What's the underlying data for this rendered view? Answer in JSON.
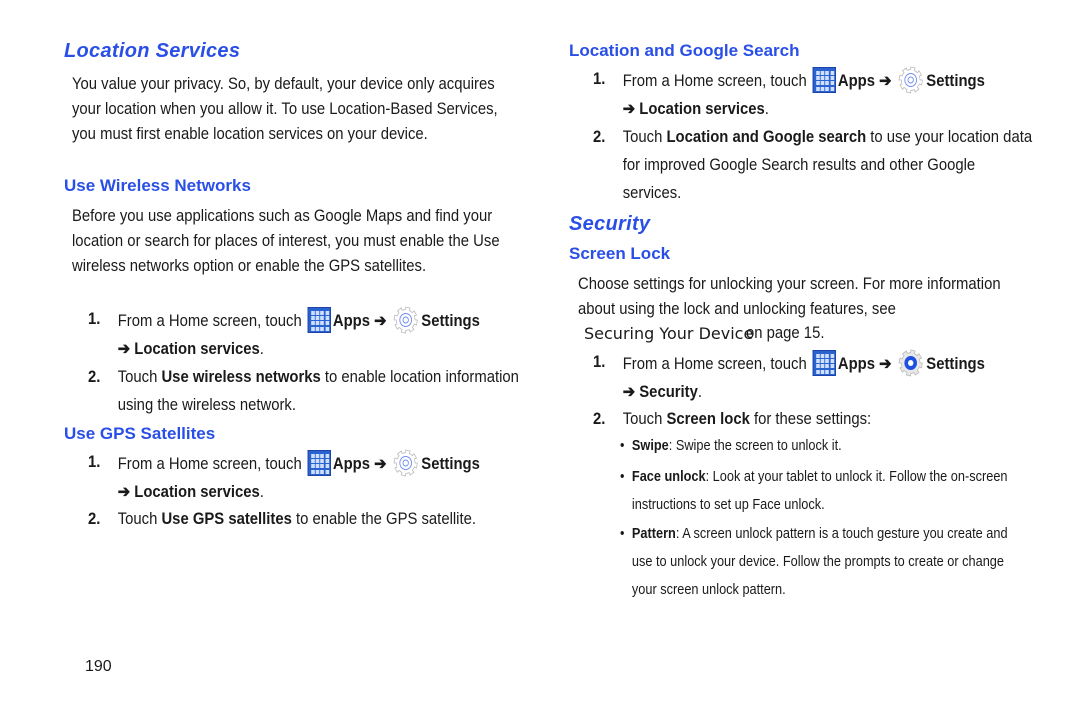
{
  "page_number": "190",
  "left": {
    "title": "Location Services",
    "intro": "You value your privacy. So, by default, your device only acquires your location when you allow it. To use Location-Based Services, you must first enable location services on your device.",
    "wireless": {
      "heading": "Use Wireless Networks",
      "intro": "Before you use applications such as Google Maps and find your location or search for places of interest, you must enable the Use wireless networks option or enable the GPS satellites.",
      "step1": {
        "num": "1.",
        "pre": "From a Home screen, touch ",
        "apps": "Apps",
        "arrow": " ➔ ",
        "settings": "Settings",
        "line2_arrow": "➔ ",
        "line2": "Location services",
        "end": "."
      },
      "step2": {
        "num": "2.",
        "pre": "Touch ",
        "bold": "Use wireless networks",
        "post": " to enable location information using the wireless network."
      }
    },
    "gps": {
      "heading": "Use GPS Satellites",
      "step1": {
        "num": "1.",
        "pre": "From a Home screen, touch ",
        "apps": "Apps",
        "arrow": " ➔ ",
        "settings": "Settings",
        "line2_arrow": "➔ ",
        "line2": "Location services",
        "end": "."
      },
      "step2": {
        "num": "2.",
        "pre": "Touch ",
        "bold": "Use GPS satellites",
        "post": " to enable the GPS satellite."
      }
    }
  },
  "right": {
    "google": {
      "heading": "Location and Google Search",
      "step1": {
        "num": "1.",
        "pre": "From a Home screen, touch ",
        "apps": "Apps",
        "arrow": " ➔ ",
        "settings": "Settings",
        "line2_arrow": "➔ ",
        "line2": "Location services",
        "end": "."
      },
      "step2": {
        "num": "2.",
        "pre": "Touch ",
        "bold": "Location and Google search",
        "post": " to use your location data for improved Google Search results and other Google services."
      }
    },
    "security": {
      "title": "Security",
      "heading": "Screen Lock",
      "intro": "Choose settings for unlocking your screen. For more information about using the lock and unlocking features, see",
      "xref_link": "Securing Your Device",
      "xref_tail": "on page 15.",
      "step1": {
        "num": "1.",
        "pre": "From a Home screen, touch ",
        "apps": "Apps",
        "arrow": " ➔ ",
        "settings": "Settings",
        "line2_arrow": "➔ ",
        "line2": "Security",
        "end": "."
      },
      "step2": {
        "num": "2.",
        "pre": "Touch ",
        "bold": "Screen lock",
        "post": " for these settings:"
      },
      "bullets": [
        {
          "label": "Swipe",
          "text": ": Swipe the screen to unlock it."
        },
        {
          "label": "Face unlock",
          "text": ": Look at your tablet to unlock it. Follow the on-screen instructions to set up Face unlock."
        },
        {
          "label": "Pattern",
          "text": ": A screen unlock pattern is a touch gesture you create and use to unlock your device. Follow the prompts to create or change your screen unlock pattern."
        }
      ]
    }
  },
  "icons": {
    "apps": "apps-grid-icon",
    "settings": "settings-gear-icon"
  },
  "colors": {
    "heading": "#2a4fe6",
    "text": "#1a1a1a",
    "apps_icon": "#2a62d0"
  }
}
